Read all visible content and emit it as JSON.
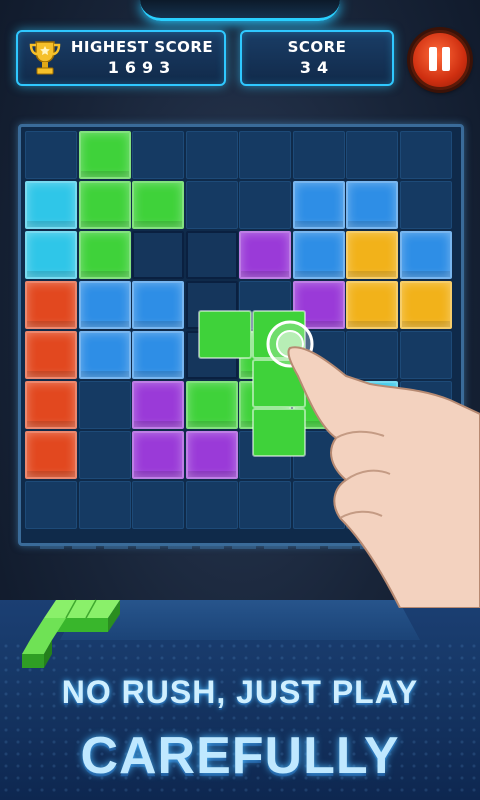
{
  "header": {
    "highest_score_label": "HIGHEST SCORE",
    "highest_score_value": "1693",
    "score_label": "SCORE",
    "score_value": "34"
  },
  "colors": {
    "cyan": "#2fc6e8",
    "green": "#3fd23a",
    "blue": "#2e8ee6",
    "red": "#e2481f",
    "purple": "#9a3ad8",
    "yellow": "#f2b21a"
  },
  "board": {
    "rows": 8,
    "cols": 8,
    "cells": [
      [
        "",
        "green",
        "",
        "",
        "",
        "",
        "",
        ""
      ],
      [
        "cyan",
        "green",
        "green",
        "",
        "",
        "blue",
        "blue",
        ""
      ],
      [
        "cyan",
        "green",
        "outline",
        "outline",
        "purple",
        "blue",
        "yellow",
        "blue"
      ],
      [
        "red",
        "blue",
        "blue",
        "outline",
        "",
        "purple",
        "yellow",
        "yellow"
      ],
      [
        "red",
        "blue",
        "blue",
        "outline",
        "green",
        "",
        "",
        ""
      ],
      [
        "red",
        "",
        "purple",
        "green",
        "green",
        "green",
        "cyan",
        ""
      ],
      [
        "red",
        "",
        "purple",
        "purple",
        "",
        "",
        "cyan",
        ""
      ],
      [
        "",
        "",
        "",
        "",
        "",
        "",
        "",
        ""
      ]
    ]
  },
  "dragged_piece": {
    "color": "green",
    "shape": "L"
  },
  "tutorial": {
    "hand_icon": "pointing-hand-icon",
    "tap_icon": "tap-ripple-icon"
  },
  "slogan": {
    "line1": "NO RUSH, JUST PLAY",
    "line2": "CAREFULLY"
  }
}
